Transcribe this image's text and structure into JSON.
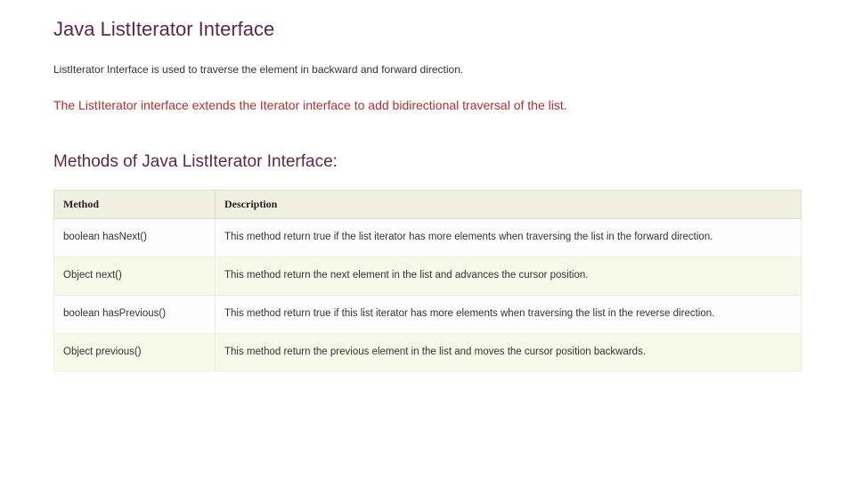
{
  "title": "Java ListIterator Interface",
  "intro": "ListIterator Interface is used to traverse the element in backward and forward direction.",
  "highlight": "The ListIterator interface extends the Iterator interface to add bidirectional traversal of the list.",
  "subheading": "Methods of Java ListIterator Interface:",
  "table": {
    "headers": {
      "method": "Method",
      "description": "Description"
    },
    "rows": [
      {
        "method": "boolean hasNext()",
        "description": "This method return true if the list iterator has more elements when traversing the list in the forward direction."
      },
      {
        "method": "Object next()",
        "description": "This method return the next element in the list and advances the cursor position."
      },
      {
        "method": "boolean hasPrevious()",
        "description": "This method return true if this list iterator has more elements when traversing the list in the reverse direction."
      },
      {
        "method": "Object previous()",
        "description": "This method return the previous element in the list and moves the cursor position backwards."
      }
    ]
  }
}
